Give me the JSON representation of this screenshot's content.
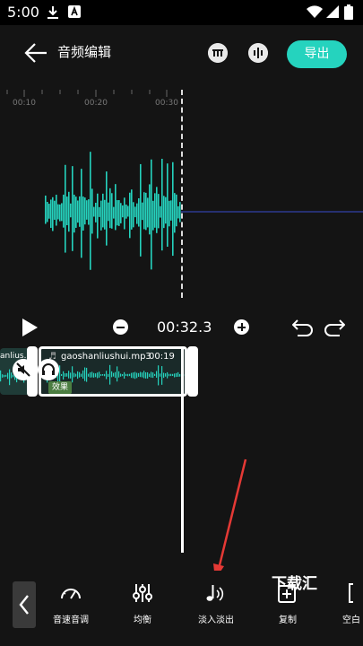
{
  "status_bar": {
    "time": "5:00"
  },
  "header": {
    "back_icon": "arrow-left-icon",
    "title": "音频编辑",
    "export_label": "导出"
  },
  "ruler": {
    "labels": [
      "00:10",
      "00:20",
      "00:30"
    ]
  },
  "transport": {
    "time": "00:32.3"
  },
  "track": {
    "left_clip_name": "anlius...",
    "clip_name": "gaoshanliushui.mp3",
    "clip_duration": "00:19",
    "effect_tag": "效果"
  },
  "toolbar": {
    "items": [
      {
        "label": "音速音调",
        "icon": "speedometer-icon"
      },
      {
        "label": "均衡",
        "icon": "equalizer-icon"
      },
      {
        "label": "淡入淡出",
        "icon": "fade-note-icon"
      },
      {
        "label": "复制",
        "icon": "copy-icon"
      },
      {
        "label": "空白",
        "icon": "blank-icon"
      }
    ]
  },
  "watermark": "下载汇",
  "colors": {
    "accent": "#25d3be",
    "background": "#141414",
    "effect_tag": "#4b7d41",
    "annotation_arrow": "#e53935"
  }
}
